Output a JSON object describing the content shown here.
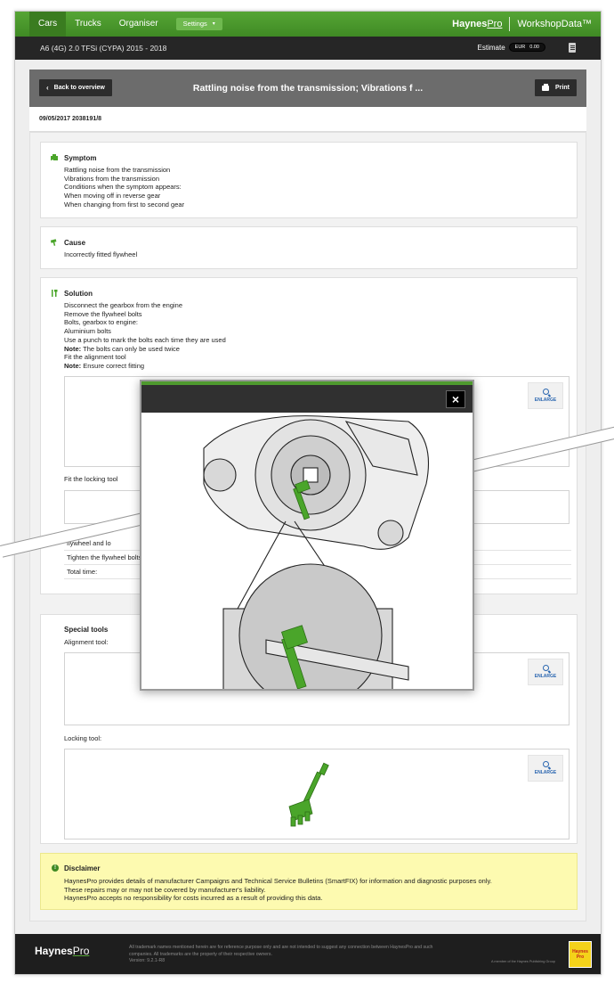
{
  "nav": {
    "tabs": [
      "Cars",
      "Trucks",
      "Organiser"
    ],
    "settings_label": "Settings",
    "brand_left": "Haynes",
    "brand_right": "Pro",
    "product": "WorkshopData™"
  },
  "vehicle": {
    "title": "A6 (4G) 2.0 TFSi (CYPA) 2015 - 2018",
    "estimate_label": "Estimate",
    "currency": "EUR",
    "amount": "0.00"
  },
  "page": {
    "back_label": "Back to overview",
    "title": "Rattling noise from the transmission; Vibrations f ...",
    "print_label": "Print",
    "reference": "09/05/2017 2038191/8"
  },
  "symptom": {
    "title": "Symptom",
    "lines": [
      "Rattling noise from the transmission",
      "Vibrations from the transmission",
      "Conditions when the symptom appears:",
      "When moving off in reverse gear",
      "When changing from first to second gear"
    ]
  },
  "cause": {
    "title": "Cause",
    "lines": [
      "Incorrectly fitted flywheel"
    ]
  },
  "solution": {
    "title": "Solution",
    "lines": [
      "Disconnect the gearbox from the engine",
      "Remove the flywheel bolts",
      "Bolts, gearbox to engine:",
      "Aluminium bolts",
      "Use a punch to mark the bolts each time they are used"
    ],
    "note1_label": "Note:",
    "note1_text": " The bolts can only be used twice",
    "line_fit_alignment": "Fit the alignment tool",
    "note2_label": "Note:",
    "note2_text": " Ensure correct fitting",
    "enlarge_label": "ENLARGE",
    "fit_locking_tool": "Fit the locking tool",
    "step_rows": [
      "flywheel and lo",
      "Tighten the flywheel bolts",
      "Total time:"
    ]
  },
  "special_tools": {
    "title": "Special tools",
    "alignment_label": "Alignment tool:",
    "locking_label": "Locking tool:",
    "enlarge_label": "ENLARGE"
  },
  "disclaimer": {
    "title": "Disclaimer",
    "lines": [
      "HaynesPro provides details of manufacturer Campaigns and Technical Service Bulletins (SmartFIX) for information and diagnostic purposes only.",
      "These repairs may or may not be covered by manufacturer's liability.",
      "HaynesPro accepts no responsibility for costs incurred as a result of providing this data."
    ]
  },
  "footer": {
    "logo_left": "Haynes",
    "logo_right": "Pro",
    "lines": [
      "All trademark names mentioned herein are for reference purpose only and are not intended to suggest any connection between HaynesPro and such",
      "companies. All trademarks are the property of their respective owners.",
      "Version: 9.2.1-R8"
    ],
    "member_text": "A member of the Haynes Publishing Group",
    "badge_line1": "Haynes",
    "badge_line2": "Pro"
  },
  "colors": {
    "accent_green": "#4f9a2f",
    "tool_green": "#4aa52a",
    "link_blue": "#2a66b0",
    "disclaimer_yellow": "#fdfab0"
  },
  "icons": {
    "symptom": "car-damage-icon",
    "cause": "hammer-icon",
    "solution": "tools-icon",
    "enlarge": "magnifier-icon",
    "close": "close-icon",
    "disclaimer": "info-circle-icon"
  }
}
